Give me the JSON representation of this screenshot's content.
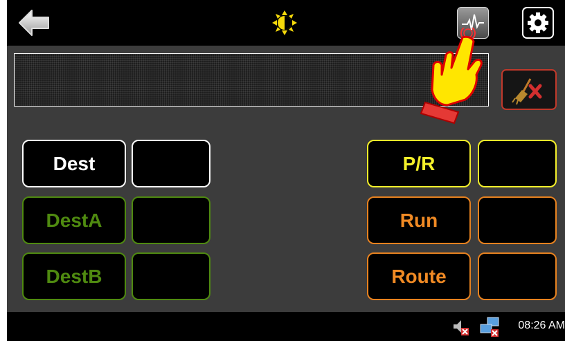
{
  "header": {
    "back_icon": "back-arrow-icon",
    "brightness_icon": "brightness-icon",
    "waveform_icon": "waveform-icon",
    "settings_icon": "gear-icon"
  },
  "display": {
    "text": ""
  },
  "clear_button": {
    "icon": "broom-clear-icon"
  },
  "left_keys": [
    {
      "label": "Dest",
      "value": "",
      "color": "#ffffff"
    },
    {
      "label": "DestA",
      "value": "",
      "color": "#4f8a10"
    },
    {
      "label": "DestB",
      "value": "",
      "color": "#4f8a10"
    }
  ],
  "right_keys": [
    {
      "label": "P/R",
      "value": "",
      "color": "#f4f02a"
    },
    {
      "label": "Run",
      "value": "",
      "color": "#f08a24"
    },
    {
      "label": "Route",
      "value": "",
      "color": "#f08a24"
    }
  ],
  "taskbar": {
    "clock": "08:26 AM",
    "speaker_icon": "speaker-muted-icon",
    "network_icon": "network-disconnected-icon"
  },
  "accent_colors": {
    "alert_red": "#d32f2f",
    "hand_yellow": "#ffe600"
  }
}
